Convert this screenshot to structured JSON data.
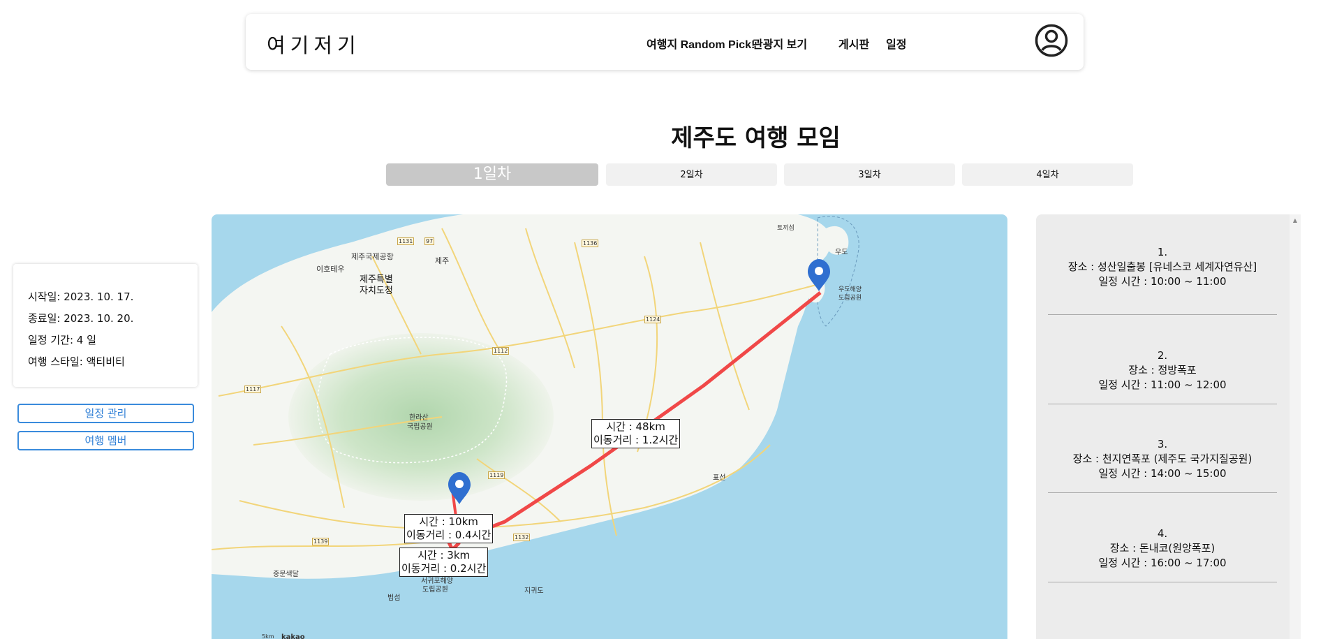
{
  "header": {
    "logo": "여기저기",
    "nav": [
      "여행지 Random Pick!",
      "관광지 보기",
      "게시판",
      "일정"
    ]
  },
  "page_title": "제주도 여행 모임",
  "day_tabs": [
    "1일차",
    "2일차",
    "3일차",
    "4일차"
  ],
  "trip_info": {
    "start": "시작일: 2023. 10. 17.",
    "end": "종료일: 2023. 10. 20.",
    "duration": "일정 기간: 4 일",
    "style": "여행 스타일: 액티비티"
  },
  "buttons": {
    "manage": "일정 관리",
    "members": "여행 멤버"
  },
  "map": {
    "route_labels": [
      {
        "line1": "시간 : 48km",
        "line2": "이동거리 : 1.2시간"
      },
      {
        "line1": "시간 : 10km",
        "line2": "이동거리 : 0.4시간"
      },
      {
        "line1": "시간 : 3km",
        "line2": "이동거리 : 0.2시간"
      }
    ],
    "places": {
      "jeju_airport": "제주국제공항",
      "ihotewoo": "이호테우",
      "jeju": "제주",
      "jeju_province": "제주특별",
      "jeju_province2": "자치도청",
      "hallasan": "한라산",
      "hallasan2": "국립공원",
      "udo": "우도",
      "udo_park": "우도해양",
      "udo_park2": "도립공원",
      "tokkiseom": "토끼섬",
      "pyoseon": "표선",
      "jungmun": "중문색달",
      "beomseom": "범섬",
      "jigwido": "지귀도",
      "seogwipo_park": "서귀포해양",
      "seogwipo_park2": "도립공원",
      "kakao": "kakao",
      "scale": "5km"
    },
    "roads": [
      "1131",
      "97",
      "1136",
      "1124",
      "1112",
      "1117",
      "1119",
      "1139",
      "1132"
    ],
    "colors": {
      "route": "#f04848",
      "marker": "#2f6fd0",
      "sea": "#a6d7ec",
      "land": "#f4f6f2"
    }
  },
  "schedule": [
    {
      "num": "1.",
      "place": "장소 : 성산일출봉 [유네스코 세계자연유산]",
      "time": "일정 시간 : 10:00 ~ 11:00"
    },
    {
      "num": "2.",
      "place": "장소 : 정방폭포",
      "time": "일정 시간 : 11:00 ~ 12:00"
    },
    {
      "num": "3.",
      "place": "장소 : 천지연폭포 (제주도 국가지질공원)",
      "time": "일정 시간 : 14:00 ~ 15:00"
    },
    {
      "num": "4.",
      "place": "장소 : 돈내코(원앙폭포)",
      "time": "일정 시간 : 16:00 ~ 17:00"
    }
  ]
}
